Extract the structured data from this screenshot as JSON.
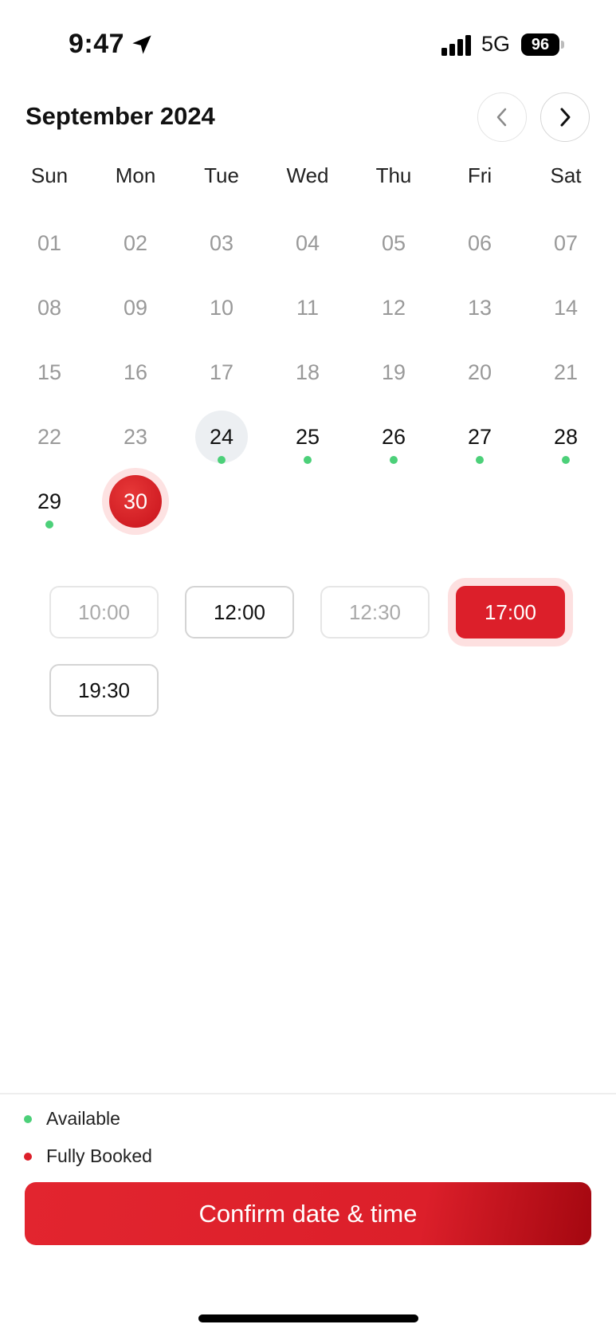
{
  "status_bar": {
    "time": "9:47",
    "network": "5G",
    "battery": "96",
    "icons": [
      "location-arrow-icon",
      "signal-bars-icon",
      "battery-icon"
    ]
  },
  "calendar": {
    "month_title": "September 2024",
    "prev_icon": "chevron-left-icon",
    "next_icon": "chevron-right-icon",
    "weekdays": [
      "Sun",
      "Mon",
      "Tue",
      "Wed",
      "Thu",
      "Fri",
      "Sat"
    ],
    "weeks": [
      [
        {
          "label": "01",
          "state": "past"
        },
        {
          "label": "02",
          "state": "past"
        },
        {
          "label": "03",
          "state": "past"
        },
        {
          "label": "04",
          "state": "past"
        },
        {
          "label": "05",
          "state": "past"
        },
        {
          "label": "06",
          "state": "past"
        },
        {
          "label": "07",
          "state": "past"
        }
      ],
      [
        {
          "label": "08",
          "state": "past"
        },
        {
          "label": "09",
          "state": "past"
        },
        {
          "label": "10",
          "state": "past"
        },
        {
          "label": "11",
          "state": "past"
        },
        {
          "label": "12",
          "state": "past"
        },
        {
          "label": "13",
          "state": "past"
        },
        {
          "label": "14",
          "state": "past"
        }
      ],
      [
        {
          "label": "15",
          "state": "past"
        },
        {
          "label": "16",
          "state": "past"
        },
        {
          "label": "17",
          "state": "past"
        },
        {
          "label": "18",
          "state": "past"
        },
        {
          "label": "19",
          "state": "past"
        },
        {
          "label": "20",
          "state": "past"
        },
        {
          "label": "21",
          "state": "past"
        }
      ],
      [
        {
          "label": "22",
          "state": "past"
        },
        {
          "label": "23",
          "state": "past"
        },
        {
          "label": "24",
          "state": "today",
          "dot": "available"
        },
        {
          "label": "25",
          "state": "avail",
          "dot": "available"
        },
        {
          "label": "26",
          "state": "avail",
          "dot": "available"
        },
        {
          "label": "27",
          "state": "avail",
          "dot": "available"
        },
        {
          "label": "28",
          "state": "avail",
          "dot": "available"
        }
      ],
      [
        {
          "label": "29",
          "state": "avail",
          "dot": "available"
        },
        {
          "label": "30",
          "state": "selected"
        }
      ]
    ]
  },
  "time_slots": [
    {
      "label": "10:00",
      "state": "disabled"
    },
    {
      "label": "12:00",
      "state": "available"
    },
    {
      "label": "12:30",
      "state": "disabled"
    },
    {
      "label": "17:00",
      "state": "selected"
    },
    {
      "label": "19:30",
      "state": "available"
    }
  ],
  "legend": [
    {
      "label": "Available",
      "color": "#4cd079"
    },
    {
      "label": "Fully Booked",
      "color": "#dc1f2a"
    }
  ],
  "confirm_label": "Confirm date & time",
  "colors": {
    "accent": "#dc1f2a",
    "available": "#4cd079",
    "selected_halo": "#fde2e2"
  }
}
